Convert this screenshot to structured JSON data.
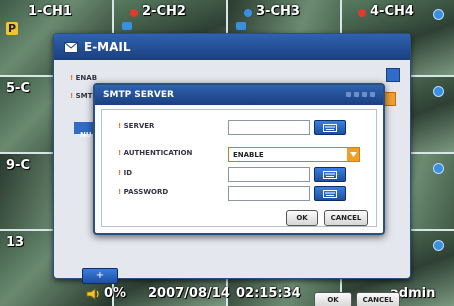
{
  "channels": [
    {
      "label": "1-CH1",
      "badge": "P"
    },
    {
      "label": "2-CH2"
    },
    {
      "label": "3-CH3"
    },
    {
      "label": "4-CH4"
    },
    {
      "label": "5-C"
    },
    {
      "label": ""
    },
    {
      "label": ""
    },
    {
      "label": ""
    },
    {
      "label": "9-C"
    },
    {
      "label": ""
    },
    {
      "label": ""
    },
    {
      "label": ""
    },
    {
      "label": "13"
    },
    {
      "label": ""
    },
    {
      "label": ""
    },
    {
      "label": ""
    }
  ],
  "status_bar": {
    "volume": "0%",
    "date": "2007/08/14",
    "time": "02:15:34",
    "user": "admin"
  },
  "email_dialog": {
    "title": "E-MAIL",
    "field_enable_label": "ENAB",
    "field_smtp_label": "SMTI",
    "table_header": "NU",
    "add_button": "+",
    "ok_button": "OK",
    "cancel_button": "CANCEL"
  },
  "smtp_dialog": {
    "title": "SMTP SERVER",
    "server_label": "SERVER",
    "server_value": "",
    "auth_label": "AUTHENTICATION",
    "auth_value": "ENABLE",
    "id_label": "ID",
    "id_value": "",
    "password_label": "PASSWORD",
    "password_value": "",
    "ok_button": "OK",
    "cancel_button": "CANCEL"
  },
  "colors": {
    "title_bar": "#2f62b0",
    "accent_orange": "#f0a020",
    "button_blue": "#2f6bc7"
  }
}
